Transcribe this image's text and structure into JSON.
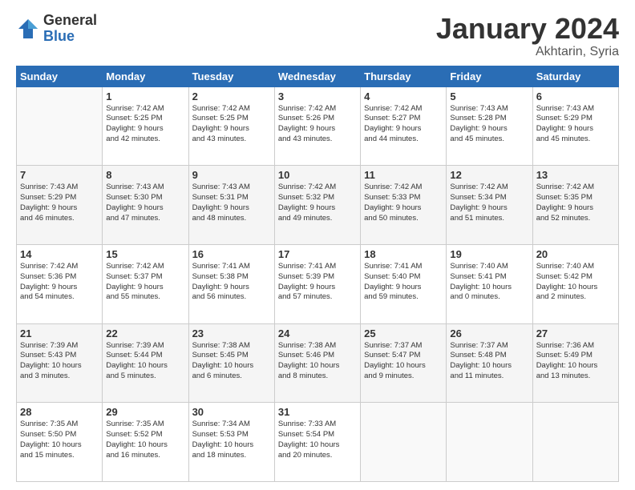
{
  "logo": {
    "general": "General",
    "blue": "Blue"
  },
  "header": {
    "title": "January 2024",
    "location": "Akhtarin, Syria"
  },
  "days_of_week": [
    "Sunday",
    "Monday",
    "Tuesday",
    "Wednesday",
    "Thursday",
    "Friday",
    "Saturday"
  ],
  "weeks": [
    [
      {
        "day": "",
        "sunrise": "",
        "sunset": "",
        "daylight": ""
      },
      {
        "day": "1",
        "sunrise": "Sunrise: 7:42 AM",
        "sunset": "Sunset: 5:25 PM",
        "daylight": "Daylight: 9 hours and 42 minutes."
      },
      {
        "day": "2",
        "sunrise": "Sunrise: 7:42 AM",
        "sunset": "Sunset: 5:25 PM",
        "daylight": "Daylight: 9 hours and 43 minutes."
      },
      {
        "day": "3",
        "sunrise": "Sunrise: 7:42 AM",
        "sunset": "Sunset: 5:26 PM",
        "daylight": "Daylight: 9 hours and 43 minutes."
      },
      {
        "day": "4",
        "sunrise": "Sunrise: 7:42 AM",
        "sunset": "Sunset: 5:27 PM",
        "daylight": "Daylight: 9 hours and 44 minutes."
      },
      {
        "day": "5",
        "sunrise": "Sunrise: 7:43 AM",
        "sunset": "Sunset: 5:28 PM",
        "daylight": "Daylight: 9 hours and 45 minutes."
      },
      {
        "day": "6",
        "sunrise": "Sunrise: 7:43 AM",
        "sunset": "Sunset: 5:29 PM",
        "daylight": "Daylight: 9 hours and 45 minutes."
      }
    ],
    [
      {
        "day": "7",
        "sunrise": "Sunrise: 7:43 AM",
        "sunset": "Sunset: 5:29 PM",
        "daylight": "Daylight: 9 hours and 46 minutes."
      },
      {
        "day": "8",
        "sunrise": "Sunrise: 7:43 AM",
        "sunset": "Sunset: 5:30 PM",
        "daylight": "Daylight: 9 hours and 47 minutes."
      },
      {
        "day": "9",
        "sunrise": "Sunrise: 7:43 AM",
        "sunset": "Sunset: 5:31 PM",
        "daylight": "Daylight: 9 hours and 48 minutes."
      },
      {
        "day": "10",
        "sunrise": "Sunrise: 7:42 AM",
        "sunset": "Sunset: 5:32 PM",
        "daylight": "Daylight: 9 hours and 49 minutes."
      },
      {
        "day": "11",
        "sunrise": "Sunrise: 7:42 AM",
        "sunset": "Sunset: 5:33 PM",
        "daylight": "Daylight: 9 hours and 50 minutes."
      },
      {
        "day": "12",
        "sunrise": "Sunrise: 7:42 AM",
        "sunset": "Sunset: 5:34 PM",
        "daylight": "Daylight: 9 hours and 51 minutes."
      },
      {
        "day": "13",
        "sunrise": "Sunrise: 7:42 AM",
        "sunset": "Sunset: 5:35 PM",
        "daylight": "Daylight: 9 hours and 52 minutes."
      }
    ],
    [
      {
        "day": "14",
        "sunrise": "Sunrise: 7:42 AM",
        "sunset": "Sunset: 5:36 PM",
        "daylight": "Daylight: 9 hours and 54 minutes."
      },
      {
        "day": "15",
        "sunrise": "Sunrise: 7:42 AM",
        "sunset": "Sunset: 5:37 PM",
        "daylight": "Daylight: 9 hours and 55 minutes."
      },
      {
        "day": "16",
        "sunrise": "Sunrise: 7:41 AM",
        "sunset": "Sunset: 5:38 PM",
        "daylight": "Daylight: 9 hours and 56 minutes."
      },
      {
        "day": "17",
        "sunrise": "Sunrise: 7:41 AM",
        "sunset": "Sunset: 5:39 PM",
        "daylight": "Daylight: 9 hours and 57 minutes."
      },
      {
        "day": "18",
        "sunrise": "Sunrise: 7:41 AM",
        "sunset": "Sunset: 5:40 PM",
        "daylight": "Daylight: 9 hours and 59 minutes."
      },
      {
        "day": "19",
        "sunrise": "Sunrise: 7:40 AM",
        "sunset": "Sunset: 5:41 PM",
        "daylight": "Daylight: 10 hours and 0 minutes."
      },
      {
        "day": "20",
        "sunrise": "Sunrise: 7:40 AM",
        "sunset": "Sunset: 5:42 PM",
        "daylight": "Daylight: 10 hours and 2 minutes."
      }
    ],
    [
      {
        "day": "21",
        "sunrise": "Sunrise: 7:39 AM",
        "sunset": "Sunset: 5:43 PM",
        "daylight": "Daylight: 10 hours and 3 minutes."
      },
      {
        "day": "22",
        "sunrise": "Sunrise: 7:39 AM",
        "sunset": "Sunset: 5:44 PM",
        "daylight": "Daylight: 10 hours and 5 minutes."
      },
      {
        "day": "23",
        "sunrise": "Sunrise: 7:38 AM",
        "sunset": "Sunset: 5:45 PM",
        "daylight": "Daylight: 10 hours and 6 minutes."
      },
      {
        "day": "24",
        "sunrise": "Sunrise: 7:38 AM",
        "sunset": "Sunset: 5:46 PM",
        "daylight": "Daylight: 10 hours and 8 minutes."
      },
      {
        "day": "25",
        "sunrise": "Sunrise: 7:37 AM",
        "sunset": "Sunset: 5:47 PM",
        "daylight": "Daylight: 10 hours and 9 minutes."
      },
      {
        "day": "26",
        "sunrise": "Sunrise: 7:37 AM",
        "sunset": "Sunset: 5:48 PM",
        "daylight": "Daylight: 10 hours and 11 minutes."
      },
      {
        "day": "27",
        "sunrise": "Sunrise: 7:36 AM",
        "sunset": "Sunset: 5:49 PM",
        "daylight": "Daylight: 10 hours and 13 minutes."
      }
    ],
    [
      {
        "day": "28",
        "sunrise": "Sunrise: 7:35 AM",
        "sunset": "Sunset: 5:50 PM",
        "daylight": "Daylight: 10 hours and 15 minutes."
      },
      {
        "day": "29",
        "sunrise": "Sunrise: 7:35 AM",
        "sunset": "Sunset: 5:52 PM",
        "daylight": "Daylight: 10 hours and 16 minutes."
      },
      {
        "day": "30",
        "sunrise": "Sunrise: 7:34 AM",
        "sunset": "Sunset: 5:53 PM",
        "daylight": "Daylight: 10 hours and 18 minutes."
      },
      {
        "day": "31",
        "sunrise": "Sunrise: 7:33 AM",
        "sunset": "Sunset: 5:54 PM",
        "daylight": "Daylight: 10 hours and 20 minutes."
      },
      {
        "day": "",
        "sunrise": "",
        "sunset": "",
        "daylight": ""
      },
      {
        "day": "",
        "sunrise": "",
        "sunset": "",
        "daylight": ""
      },
      {
        "day": "",
        "sunrise": "",
        "sunset": "",
        "daylight": ""
      }
    ]
  ]
}
